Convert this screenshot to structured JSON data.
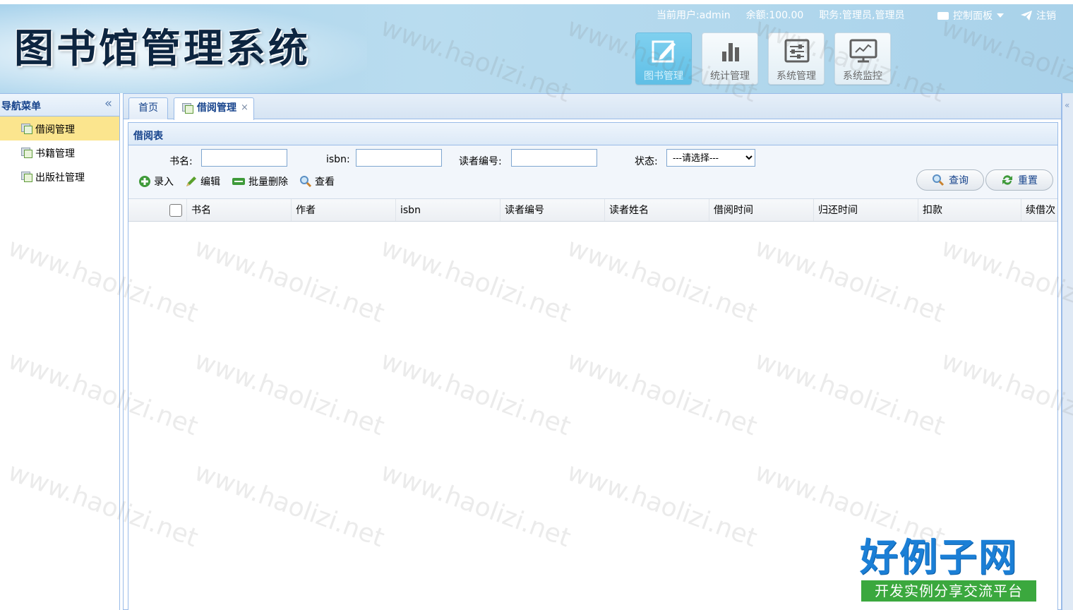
{
  "header": {
    "app_title": "图书馆管理系统",
    "user_label": "当前用户:",
    "user_value": "admin",
    "balance_label": "余额:",
    "balance_value": "100.00",
    "role_label": "职务:",
    "role_value": "管理员,管理员",
    "control_panel": "控制面板",
    "logout": "注销"
  },
  "modules": [
    {
      "label": "图书管理",
      "icon": "edit-icon",
      "active": true
    },
    {
      "label": "统计管理",
      "icon": "bar-chart-icon",
      "active": false
    },
    {
      "label": "系统管理",
      "icon": "settings-sliders-icon",
      "active": false
    },
    {
      "label": "系统监控",
      "icon": "monitor-icon",
      "active": false
    }
  ],
  "sidebar": {
    "title": "导航菜单",
    "collapse": "«",
    "items": [
      {
        "label": "借阅管理",
        "active": true
      },
      {
        "label": "书籍管理",
        "active": false
      },
      {
        "label": "出版社管理",
        "active": false
      }
    ]
  },
  "tabs": {
    "home": "首页",
    "active": "借阅管理",
    "close": "×"
  },
  "panel": {
    "title": "借阅表"
  },
  "filters": {
    "book_name_label": "书名:",
    "isbn_label": "isbn:",
    "reader_no_label": "读者编号:",
    "status_label": "状态:",
    "status_selected": "---请选择---"
  },
  "actions": {
    "add": "录入",
    "edit": "编辑",
    "batch_delete": "批量删除",
    "view": "查看",
    "query": "查询",
    "reset": "重置"
  },
  "grid": {
    "columns": [
      "书名",
      "作者",
      "isbn",
      "读者编号",
      "读者姓名",
      "借阅时间",
      "归还时间",
      "扣款",
      "续借次"
    ]
  },
  "watermark": "www.haolizi.net",
  "logo": {
    "top": "好例子网",
    "bottom": "开发实例分享交流平台"
  },
  "colors": {
    "header_bg": "#a9d3ec",
    "nav_active": "#fbe58e",
    "title_blue": "#15428b",
    "border_blue": "#99bbe8"
  }
}
